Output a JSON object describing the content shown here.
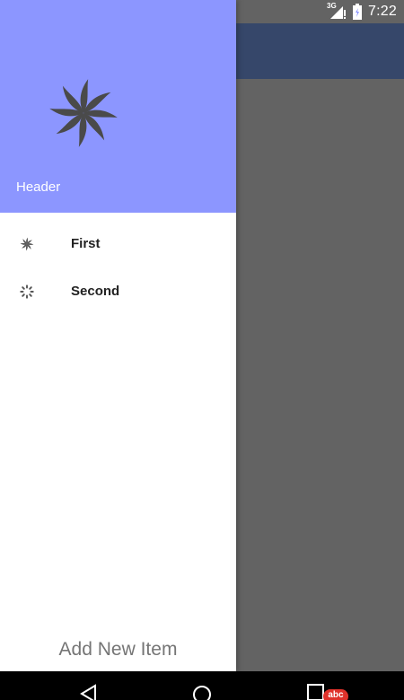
{
  "status_bar": {
    "network": "3G",
    "time": "7:22"
  },
  "drawer": {
    "header": {
      "title": "Header"
    },
    "items": [
      {
        "label": "First",
        "icon": "pinwheel-icon"
      },
      {
        "label": "Second",
        "icon": "loading-spinner-icon"
      }
    ],
    "footer_action": "Add New Item"
  },
  "nav_bar": {
    "badge": "abc"
  },
  "colors": {
    "header_bg": "#8c96ff",
    "toolbar_bg": "#36476a",
    "scrim": "#636363",
    "nav_bar": "#000000",
    "badge": "#e0322b"
  }
}
